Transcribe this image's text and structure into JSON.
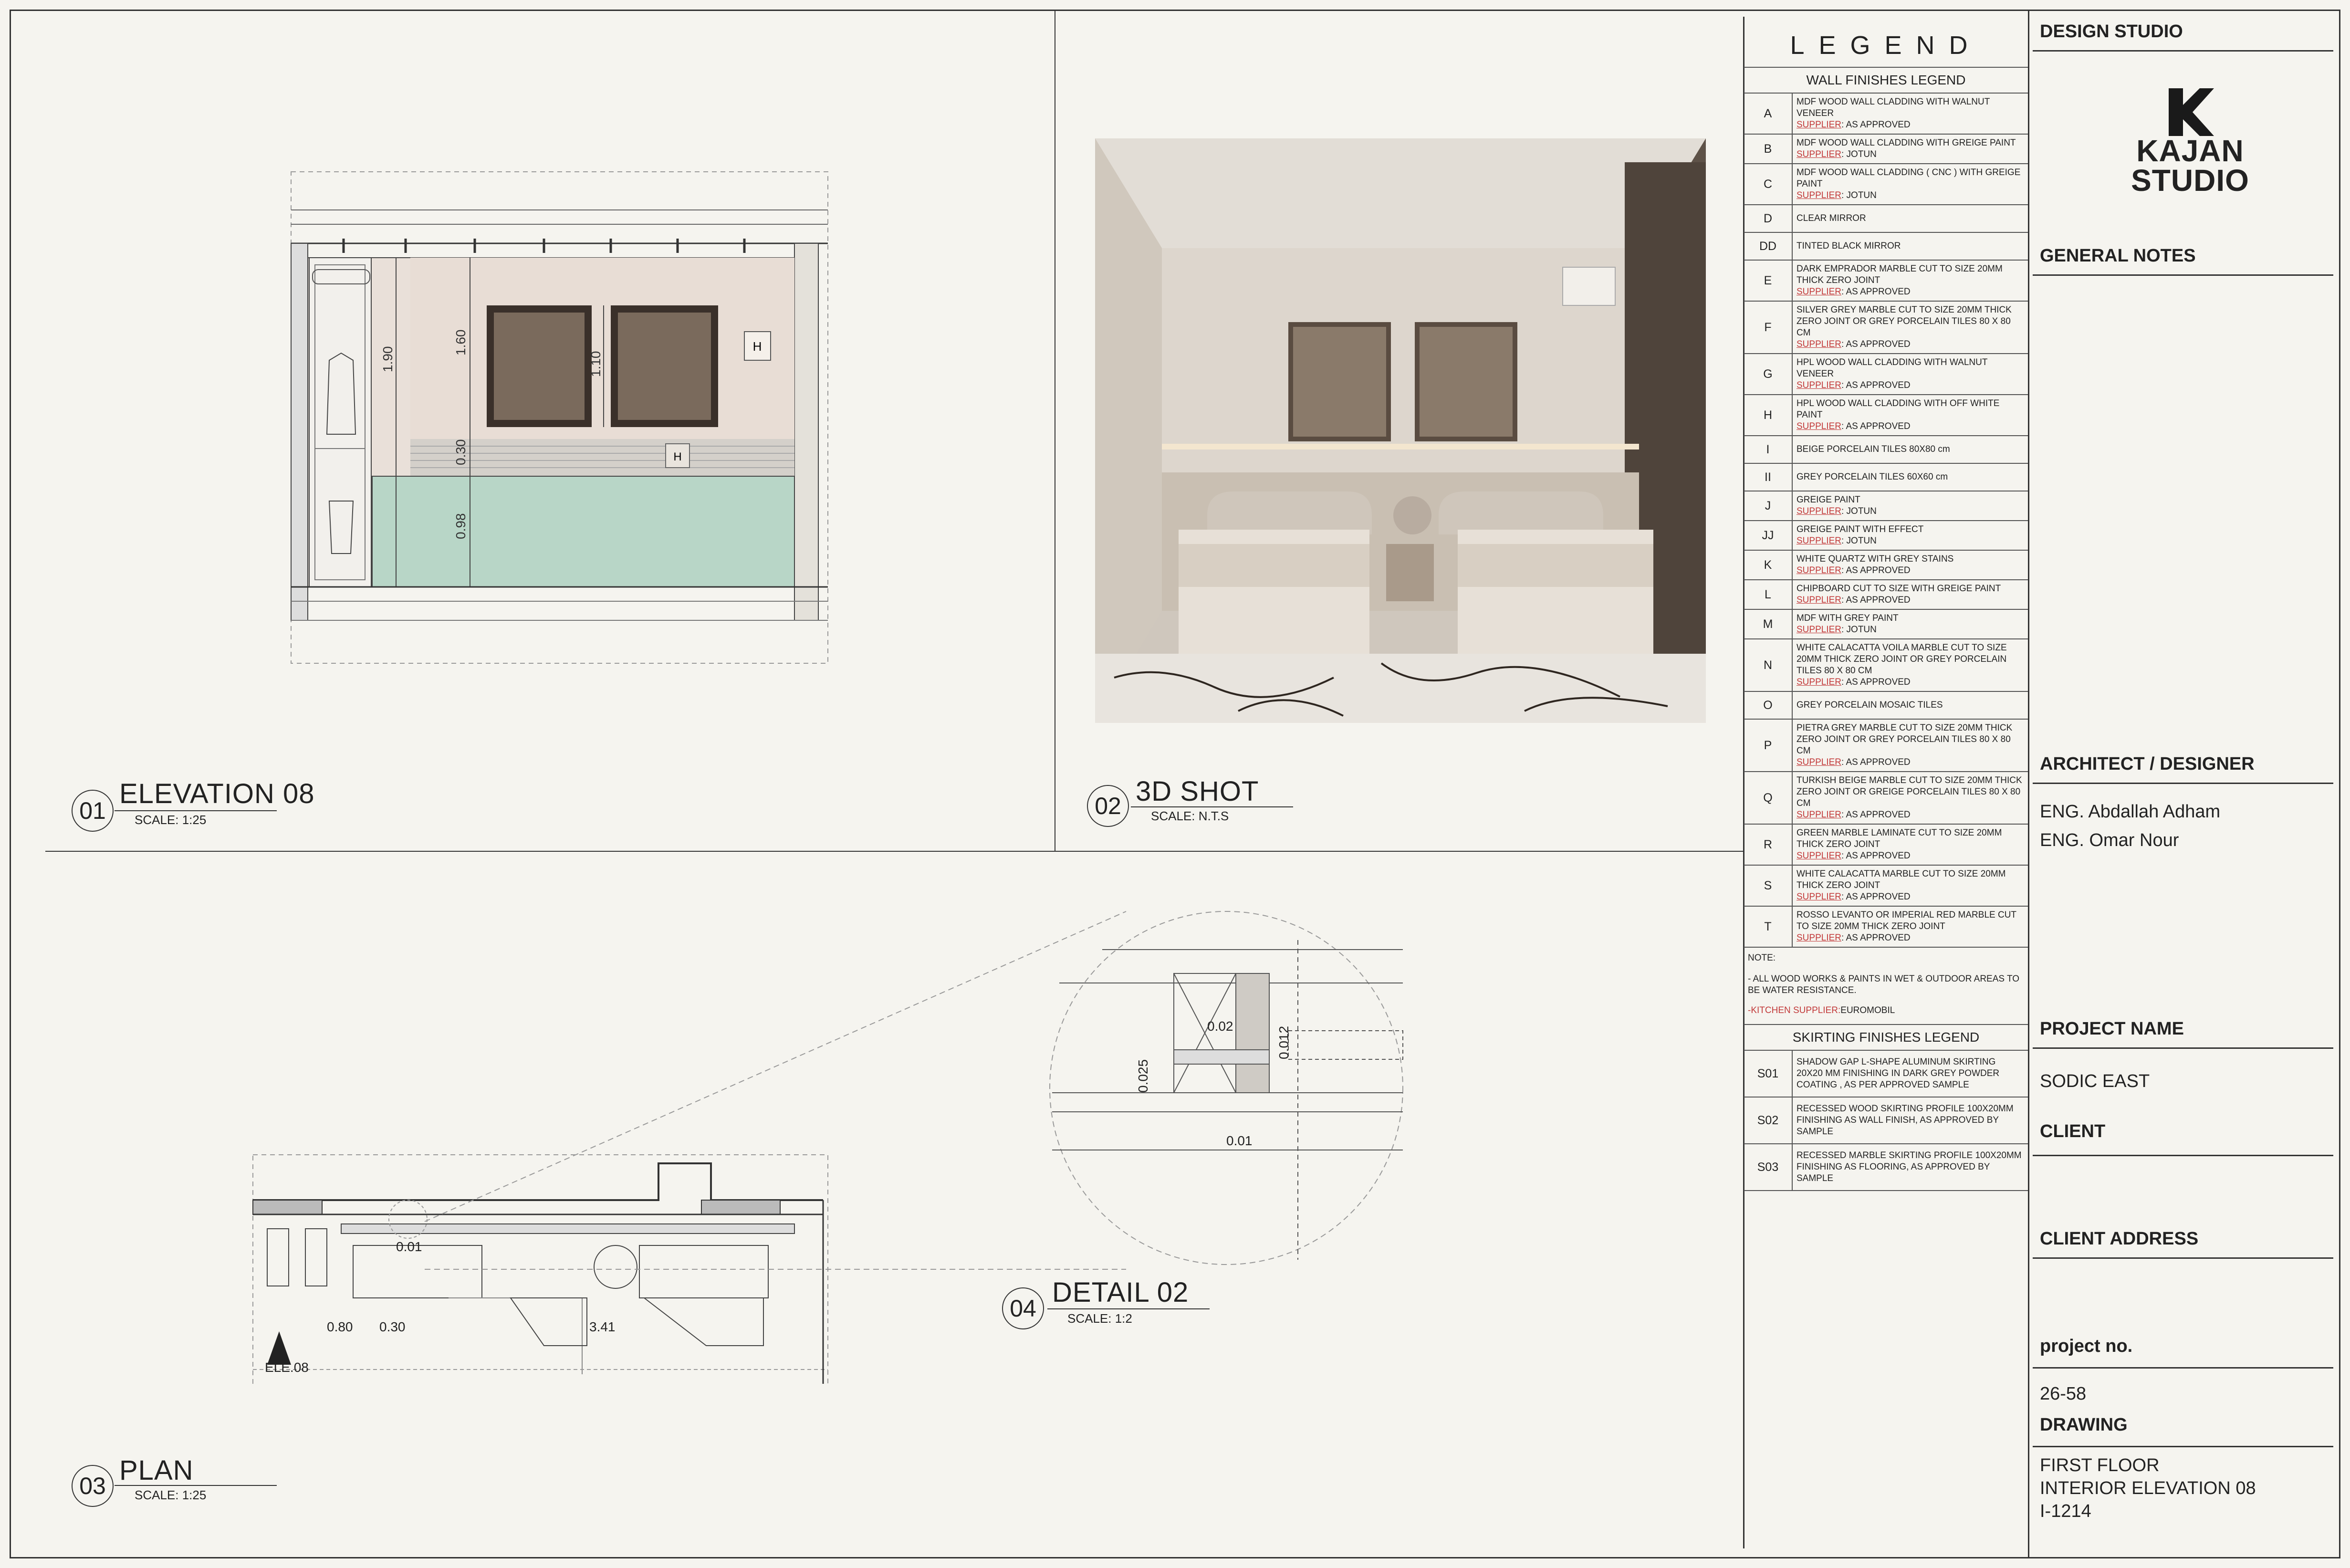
{
  "views": {
    "v01": {
      "num": "01",
      "title": "ELEVATION 08",
      "scale": "SCALE: 1:25"
    },
    "v02": {
      "num": "02",
      "title": "3D SHOT",
      "scale": "SCALE: N.T.S"
    },
    "v03": {
      "num": "03",
      "title": "PLAN",
      "scale": "SCALE: 1:25"
    },
    "v04": {
      "num": "04",
      "title": "DETAIL 02",
      "scale": "SCALE: 1:2"
    }
  },
  "elevation": {
    "d1": "1.90",
    "d2": "1.60",
    "d3": "1.10",
    "d4": "0.30",
    "d5": "0.98",
    "tag1": "H",
    "tag2": "H"
  },
  "plan": {
    "d1": "0.01",
    "d2": "0.80",
    "d3": "0.30",
    "d4": "3.41",
    "tag": "ELE.08"
  },
  "detail": {
    "d1": "0.02",
    "d2": "0.012",
    "d3": "0.025",
    "d4": "0.01"
  },
  "legend": {
    "heading": "LEGEND",
    "wall_title": "WALL FINISHES LEGEND",
    "supplier_label": "SUPPLIER",
    "wall_rows": [
      {
        "code": "A",
        "text": "MDF WOOD WALL CLADDING WITH WALNUT VENEER",
        "supplier": ": AS APPROVED"
      },
      {
        "code": "B",
        "text": "MDF WOOD WALL CLADDING WITH  GREIGE PAINT",
        "supplier": ": JOTUN"
      },
      {
        "code": "C",
        "text": "MDF WOOD WALL CLADDING ( CNC ) WITH GREIGE PAINT",
        "supplier": ": JOTUN"
      },
      {
        "code": "D",
        "text": "CLEAR MIRROR",
        "supplier": ""
      },
      {
        "code": "DD",
        "text": "TINTED BLACK MIRROR",
        "supplier": ""
      },
      {
        "code": "E",
        "text": "DARK EMPRADOR MARBLE CUT TO SIZE 20MM THICK ZERO JOINT",
        "supplier": ": AS APPROVED"
      },
      {
        "code": "F",
        "text": "SILVER GREY MARBLE CUT TO SIZE 20MM THICK ZERO JOINT OR GREY PORCELAIN TILES 80 X 80 CM",
        "supplier": ": AS APPROVED"
      },
      {
        "code": "G",
        "text": "HPL WOOD WALL CLADDING WITH WALNUT VENEER",
        "supplier": ": AS APPROVED"
      },
      {
        "code": "H",
        "text": "HPL WOOD WALL CLADDING WITH OFF WHITE PAINT",
        "supplier": ": AS APPROVED"
      },
      {
        "code": "I",
        "text": "BEIGE PORCELAIN TILES  80X80 cm",
        "supplier": ""
      },
      {
        "code": "II",
        "text": "GREY PORCELAIN TILES  60X60 cm",
        "supplier": ""
      },
      {
        "code": "J",
        "text": "GREIGE PAINT",
        "supplier": ": JOTUN"
      },
      {
        "code": "JJ",
        "text": "GREIGE PAINT WITH EFFECT",
        "supplier": ": JOTUN"
      },
      {
        "code": "K",
        "text": "WHITE QUARTZ WITH GREY STAINS",
        "supplier": ": AS APPROVED"
      },
      {
        "code": "L",
        "text": "CHIPBOARD  CUT TO SIZE WITH GREIGE PAINT",
        "supplier": ": AS APPROVED"
      },
      {
        "code": "M",
        "text": "MDF WITH GREY PAINT",
        "supplier": ": JOTUN"
      },
      {
        "code": "N",
        "text": "WHITE CALACATTA VOILA MARBLE CUT TO SIZE 20MM THICK ZERO JOINT OR GREY PORCELAIN TILES 80 X 80 CM",
        "supplier": ": AS APPROVED"
      },
      {
        "code": "O",
        "text": "GREY PORCELAIN MOSAIC TILES",
        "supplier": ""
      },
      {
        "code": "P",
        "text": "PIETRA GREY  MARBLE CUT TO SIZE 20MM THICK ZERO JOINT OR GREY PORCELAIN TILES 80 X 80 CM",
        "supplier": ": AS APPROVED"
      },
      {
        "code": "Q",
        "text": "TURKISH BEIGE MARBLE CUT TO SIZE 20MM THICK ZERO JOINT OR GREIGE PORCELAIN TILES 80 X 80 CM",
        "supplier": ": AS APPROVED"
      },
      {
        "code": "R",
        "text": "GREEN MARBLE LAMINATE CUT TO SIZE 20MM THICK ZERO JOINT",
        "supplier": ": AS APPROVED"
      },
      {
        "code": "S",
        "text": "WHITE CALACATTA MARBLE CUT TO SIZE 20MM THICK ZERO JOINT",
        "supplier": ": AS APPROVED"
      },
      {
        "code": "T",
        "text": "ROSSO LEVANTO OR IMPERIAL RED MARBLE CUT TO SIZE 20MM THICK ZERO JOINT",
        "supplier": ": AS APPROVED"
      }
    ],
    "note_label": "NOTE:",
    "note_text": "- ALL WOOD WORKS & PAINTS IN WET & OUTDOOR AREAS TO BE WATER RESISTANCE.",
    "kitchen_label": "-KITCHEN SUPPLIER:",
    "kitchen_value": "EUROMOBIL",
    "skirting_title": "SKIRTING FINISHES LEGEND",
    "skirting_rows": [
      {
        "code": "S01",
        "text": "SHADOW GAP L-SHAPE ALUMINUM SKIRTING 20X20 MM FINISHING IN DARK GREY POWDER COATING , AS PER APPROVED SAMPLE"
      },
      {
        "code": "S02",
        "text": "RECESSED WOOD SKIRTING PROFILE 100X20MM FINISHING AS WALL FINISH, AS APPROVED BY SAMPLE"
      },
      {
        "code": "S03",
        "text": "RECESSED MARBLE SKIRTING PROFILE 100X20MM FINISHING AS FLOORING, AS APPROVED BY SAMPLE"
      }
    ]
  },
  "title_block": {
    "design_studio": "DESIGN STUDIO",
    "logo_line1": "KAJAN",
    "logo_line2": "STUDIO",
    "general_notes": "GENERAL NOTES",
    "architect_label": "ARCHITECT / DESIGNER",
    "architect_1": "ENG. Abdallah Adham",
    "architect_2": "ENG. Omar Nour",
    "project_name_label": "PROJECT NAME",
    "project_name": "SODIC EAST",
    "client_label": "CLIENT",
    "client_address_label": "CLIENT ADDRESS",
    "project_no_label": "project no.",
    "project_no": "26-58",
    "drawing_label": "DRAWING",
    "drawing_1": "FIRST FLOOR",
    "drawing_2": "INTERIOR ELEVATION 08",
    "drawing_3": "I-1214"
  }
}
